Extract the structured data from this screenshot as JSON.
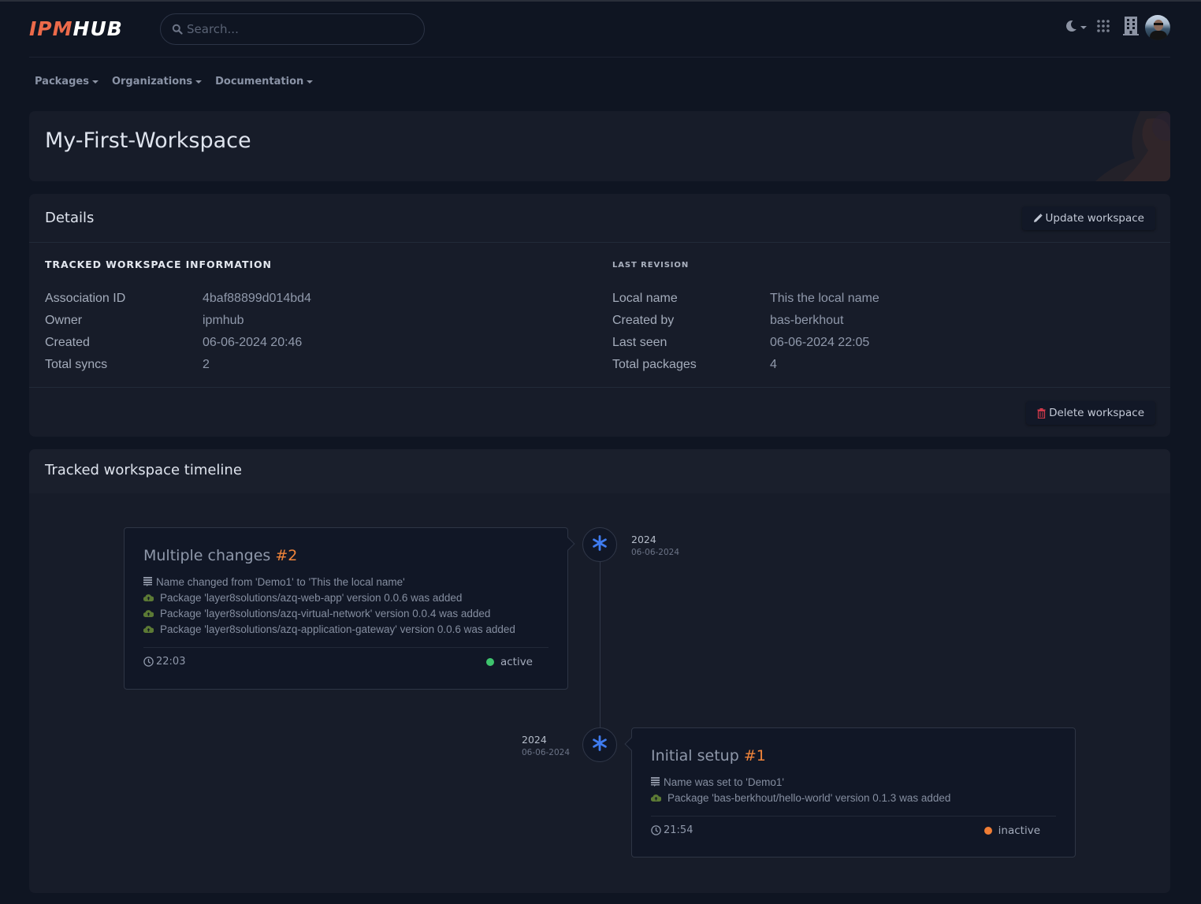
{
  "header": {
    "logo": {
      "part1": "IPM",
      "part2": "HUB"
    },
    "search": {
      "placeholder": "Search...",
      "value": ""
    },
    "icons": [
      "moon-icon",
      "apps-grid-icon",
      "building-icon",
      "user-avatar"
    ]
  },
  "nav": {
    "items": [
      {
        "label": "Packages"
      },
      {
        "label": "Organizations"
      },
      {
        "label": "Documentation"
      }
    ]
  },
  "page": {
    "title": "My-First-Workspace"
  },
  "details": {
    "title": "Details",
    "update_label": "Update workspace",
    "delete_label": "Delete workspace",
    "tracked": {
      "heading": "TRACKED WORKSPACE INFORMATION",
      "rows": [
        {
          "key": "Association ID",
          "value": "4baf88899d014bd4"
        },
        {
          "key": "Owner",
          "value": "ipmhub"
        },
        {
          "key": "Created",
          "value": "06-06-2024 20:46"
        },
        {
          "key": "Total syncs",
          "value": "2"
        }
      ]
    },
    "last_revision": {
      "heading": "LAST REVISION",
      "rows": [
        {
          "key": "Local name",
          "value": "This the local name"
        },
        {
          "key": "Created by",
          "value": "bas-berkhout"
        },
        {
          "key": "Last seen",
          "value": "06-06-2024 22:05"
        },
        {
          "key": "Total packages",
          "value": "4"
        }
      ]
    }
  },
  "timeline": {
    "title": "Tracked workspace timeline",
    "entries": [
      {
        "title": "Multiple changes",
        "number": "#2",
        "year": "2024",
        "date": "06-06-2024",
        "changes": [
          {
            "type": "name",
            "text": "Name changed from 'Demo1' to 'This the local name'"
          },
          {
            "type": "package",
            "text": "Package 'layer8solutions/azq-web-app' version 0.0.6 was added"
          },
          {
            "type": "package",
            "text": "Package 'layer8solutions/azq-virtual-network' version 0.0.4 was added"
          },
          {
            "type": "package",
            "text": "Package 'layer8solutions/azq-application-gateway' version 0.0.6 was added"
          }
        ],
        "time": "22:03",
        "status": "active",
        "status_color": "#3ec46d"
      },
      {
        "title": "Initial setup",
        "number": "#1",
        "year": "2024",
        "date": "06-06-2024",
        "changes": [
          {
            "type": "name",
            "text": "Name was set to 'Demo1'"
          },
          {
            "type": "package",
            "text": "Package 'bas-berkhout/hello-world' version 0.1.3 was added"
          }
        ],
        "time": "21:54",
        "status": "inactive",
        "status_color": "#f07d34"
      }
    ]
  },
  "colors": {
    "brand": "#ec6a4a",
    "accent_number": "#f0843a",
    "node_icon": "#3f7cf0",
    "delete_icon": "#d0394a",
    "package_icon": "#5c7a35"
  }
}
